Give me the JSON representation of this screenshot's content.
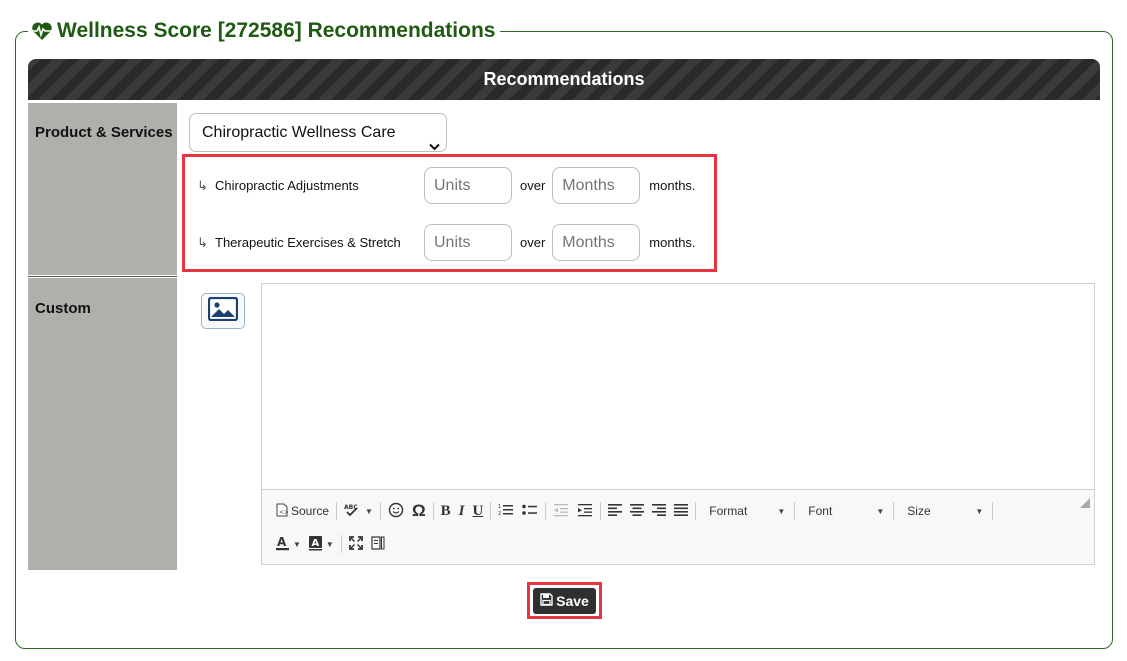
{
  "panel": {
    "title": "Wellness Score [272586] Recommendations",
    "icon": "heartbeat-icon"
  },
  "section_header": "Recommendations",
  "product_services": {
    "label": "Product & Services",
    "selected": "Chiropractic Wellness Care",
    "services": [
      {
        "name": "Chiropractic Adjustments",
        "units_placeholder": "Units",
        "over": "over",
        "months_placeholder": "Months",
        "suffix": "months."
      },
      {
        "name": "Therapeutic Exercises & Stretch",
        "units_placeholder": "Units",
        "over": "over",
        "months_placeholder": "Months",
        "suffix": "months."
      }
    ]
  },
  "custom": {
    "label": "Custom",
    "image_button_icon": "image-icon"
  },
  "toolbar": {
    "source": "Source",
    "format": "Format",
    "font": "Font",
    "size": "Size"
  },
  "save_label": "Save",
  "colors": {
    "title_green": "#1f5a12",
    "highlight_red": "#e8343f",
    "label_bg": "#b0afac"
  }
}
